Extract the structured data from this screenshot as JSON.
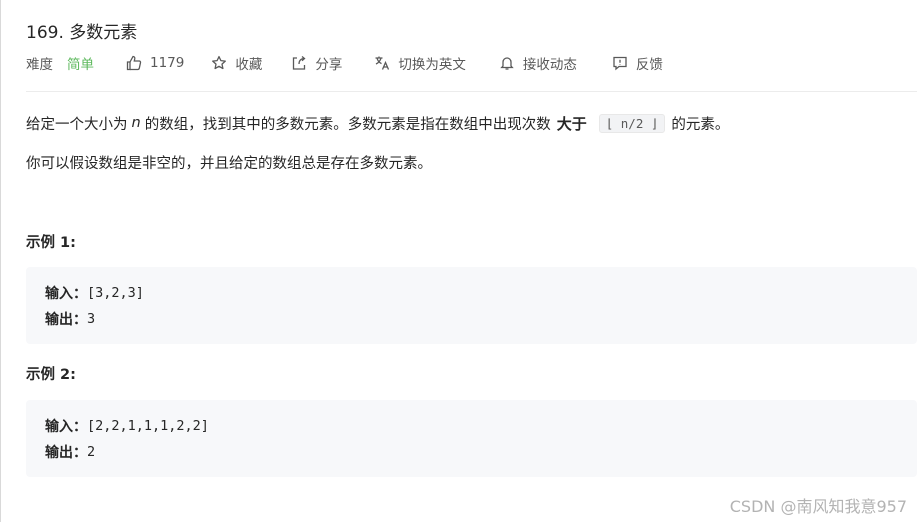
{
  "problem": {
    "title": "169. 多数元素"
  },
  "meta": {
    "difficulty_label": "难度",
    "difficulty": "简单",
    "likes": "1179",
    "favorite": "收藏",
    "share": "分享",
    "translate": "切换为英文",
    "notify": "接收动态",
    "feedback": "反馈",
    "difficulty_color": "#5cb85c"
  },
  "description": {
    "line1_pre": "给定一个大小为",
    "line1_var": "n",
    "line1_mid": "的数组，找到其中的多数元素。多数元素是指在数组中出现次数",
    "line1_strong": "大于",
    "line1_code": "⌊ n/2 ⌋",
    "line1_post": "的元素。",
    "line2": "你可以假设数组是非空的，并且给定的数组总是存在多数元素。"
  },
  "examples": [
    {
      "title": "示例 1:",
      "input_label": "输入：",
      "input": "[3,2,3]",
      "output_label": "输出：",
      "output": "3"
    },
    {
      "title": "示例 2:",
      "input_label": "输入：",
      "input": "[2,2,1,1,1,2,2]",
      "output_label": "输出：",
      "output": "2"
    }
  ],
  "watermark": "CSDN @南风知我意957",
  "icons": [
    "thumbs-up-icon",
    "star-icon",
    "share-icon",
    "translate-icon",
    "bell-icon",
    "feedback-icon"
  ]
}
